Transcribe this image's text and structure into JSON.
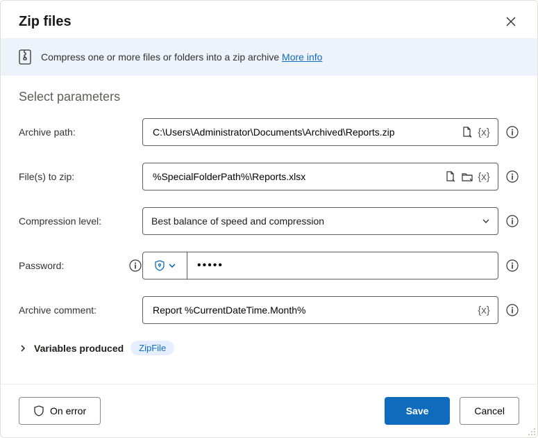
{
  "title": "Zip files",
  "banner": {
    "text": "Compress one or more files or folders into a zip archive ",
    "linkText": "More info"
  },
  "sectionTitle": "Select parameters",
  "rows": {
    "archivePath": {
      "label": "Archive path:",
      "value": "C:\\Users\\Administrator\\Documents\\Archived\\Reports.zip"
    },
    "filesToZip": {
      "label": "File(s) to zip:",
      "value": "%SpecialFolderPath%\\Reports.xlsx"
    },
    "compression": {
      "label": "Compression level:",
      "value": "Best balance of speed and compression"
    },
    "password": {
      "label": "Password:",
      "value": "•••••"
    },
    "comment": {
      "label": "Archive comment:",
      "value": "Report %CurrentDateTime.Month%"
    }
  },
  "variablesProduced": {
    "label": "Variables produced",
    "chip": "ZipFile"
  },
  "footer": {
    "onError": "On error",
    "save": "Save",
    "cancel": "Cancel"
  }
}
